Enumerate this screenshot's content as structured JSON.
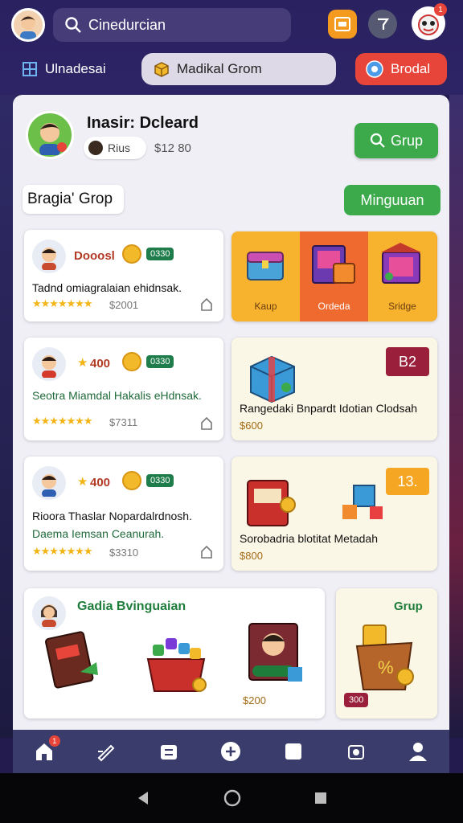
{
  "header": {
    "search_text": "Cinedurcian",
    "notification_count": "1"
  },
  "tabs": {
    "left_label": "Ulnadesai",
    "center_label": "Madikal Grom",
    "right_label": "Brodal"
  },
  "profile": {
    "name": "Inasir: Dcleard",
    "chip_label": "Rius",
    "coins": "$12 80",
    "grup_button": "Grup"
  },
  "section": {
    "label": "Bragia' Grop",
    "action_button": "Minguuan"
  },
  "cards": [
    {
      "title": "Dooosl",
      "badge": "0330",
      "desc": "Tadnd omiagralaian ehidnsak.",
      "desc2": "",
      "price": "$2001"
    },
    {
      "title": "400",
      "badge": "0330",
      "desc": "Seotra Miamdal Hakalis eHdnsak.",
      "desc2": "",
      "price": "$7311"
    },
    {
      "title": "400",
      "badge": "0330",
      "desc": "Rioora Thaslar Nopardalrdnosh.",
      "desc2": "Daema Iemsan Ceanurah.",
      "price": "$3310"
    }
  ],
  "promos": {
    "tri_labels": [
      "Kaup",
      "Ordeda",
      "Sridge"
    ],
    "promo2_text": "Rangedaki Bnpardt Idotian Clodsah",
    "promo2_price": "$600",
    "promo2_tag": "B2",
    "promo3_text": "Sorobadria blotitat Metadah",
    "promo3_price": "$800",
    "promo3_tag": "13."
  },
  "bottom": {
    "title": "Gadia Bvinguaian",
    "price": "$200",
    "side_title": "Grup",
    "side_badge": "300"
  },
  "nav": {
    "home_badge": "1"
  },
  "colors": {
    "accent_green": "#3ca94b",
    "accent_red": "#e8453a",
    "header_bg": "#2a2160"
  }
}
